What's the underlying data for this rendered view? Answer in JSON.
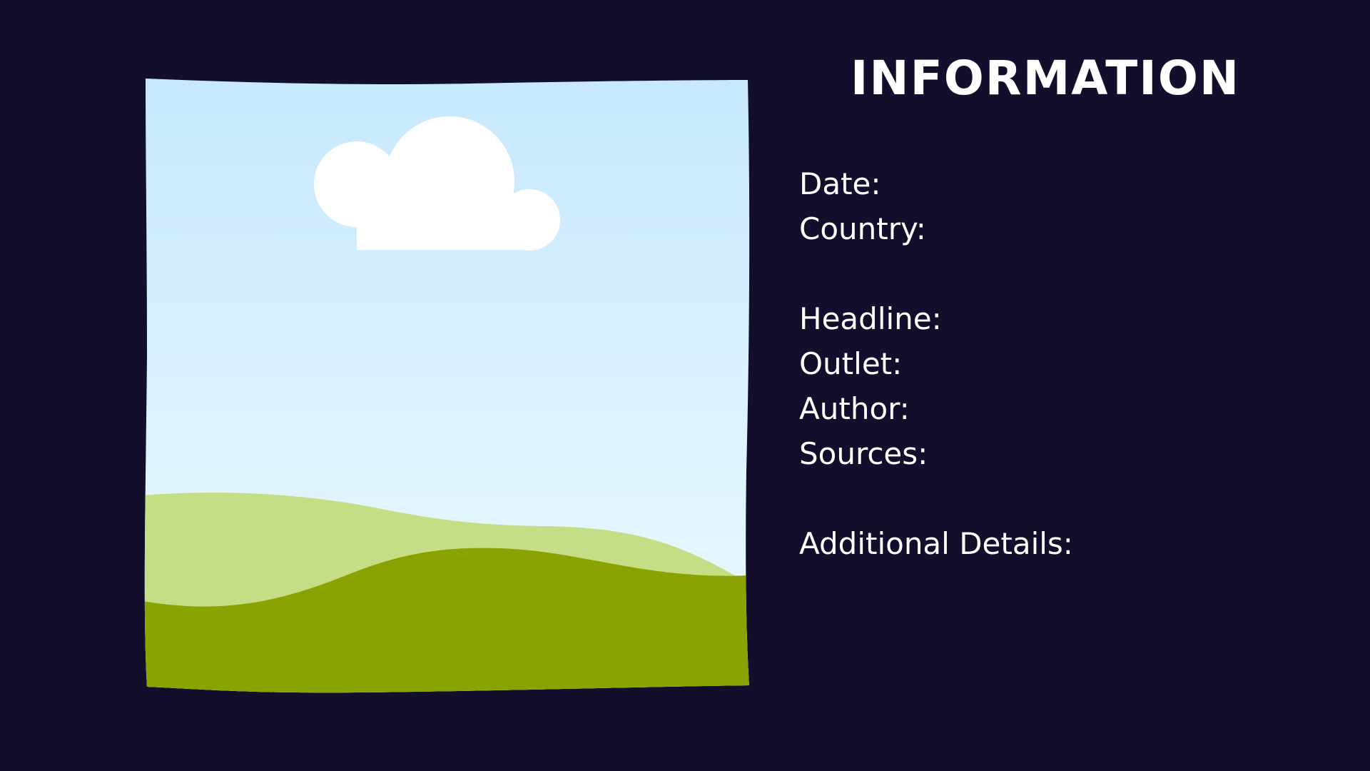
{
  "heading": "INFORMATION",
  "fields": [
    "Date:",
    "Country:",
    "Headline:",
    "Outlet:",
    "Author:",
    "Sources:",
    "Additional Details:"
  ],
  "colors": {
    "background": "#120e2b",
    "text": "#ffffff",
    "sky_top": "#c6e8fd",
    "sky_bottom": "#eefaff",
    "hill_back": "#c5dd85",
    "hill_front": "#8aa300",
    "cloud": "#ffffff"
  },
  "icons": {
    "picture": "image-placeholder-icon",
    "cloud": "cloud-icon"
  }
}
